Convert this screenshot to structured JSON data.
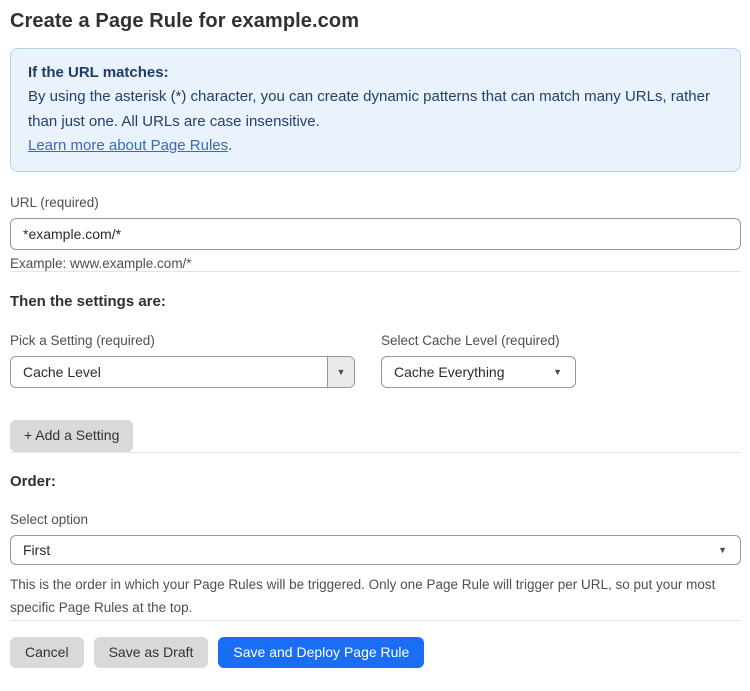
{
  "page": {
    "title": "Create a Page Rule for example.com"
  },
  "info_box": {
    "heading": "If the URL matches:",
    "body": "By using the asterisk (*) character, you can create dynamic patterns that can match many URLs, rather than just one. All URLs are case insensitive.",
    "link_label": "Learn more about Page Rules",
    "link_suffix": "."
  },
  "url_field": {
    "label": "URL (required)",
    "value": "*example.com/*",
    "help": "Example: www.example.com/*"
  },
  "settings_section": {
    "heading": "Then the settings are:",
    "setting_picker": {
      "label": "Pick a Setting (required)",
      "value": "Cache Level"
    },
    "cache_level_picker": {
      "label": "Select Cache Level (required)",
      "value": "Cache Everything"
    },
    "add_setting_label": "+ Add a Setting"
  },
  "order_section": {
    "heading": "Order:",
    "label": "Select option",
    "value": "First",
    "help": "This is the order in which your Page Rules will be triggered. Only one Page Rule will trigger per URL, so put your most specific Page Rules at the top."
  },
  "actions": {
    "cancel_label": "Cancel",
    "save_draft_label": "Save as Draft",
    "save_deploy_label": "Save and Deploy Page Rule"
  },
  "icons": {
    "dropdown_arrow": "▼"
  },
  "colors": {
    "accent_blue": "#1a6ef5",
    "info_background": "#e9f2fd",
    "info_border": "#b9d3ef",
    "info_text": "#21406f",
    "link_blue": "#3968c9",
    "gray_button": "#d9d9d9"
  }
}
